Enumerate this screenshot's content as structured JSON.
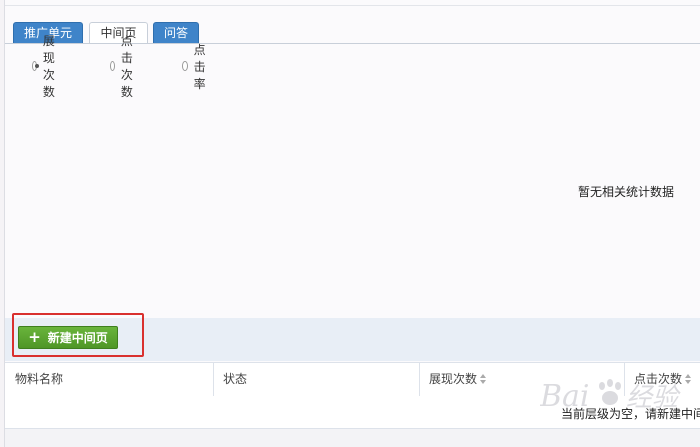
{
  "tabs": [
    {
      "label": "推广单元",
      "active": false
    },
    {
      "label": "中间页",
      "active": true
    },
    {
      "label": "问答",
      "active": false
    }
  ],
  "metrics": {
    "options": [
      {
        "label": "展现次数",
        "checked": true
      },
      {
        "label": "点击次数",
        "checked": false
      },
      {
        "label": "点击率",
        "checked": false
      }
    ]
  },
  "chart_area": {
    "empty_text": "暂无相关统计数据"
  },
  "toolbar": {
    "new_button_label": "新建中间页"
  },
  "table": {
    "columns": [
      "物料名称",
      "状态",
      "展现次数",
      "点击次数"
    ],
    "empty_text": "当前层级为空，请新建中间页"
  },
  "watermark": {
    "text": "Bai经验"
  },
  "colors": {
    "tab_blue": "#3f84c9",
    "button_green": "#5aa52f",
    "highlight_red": "#d9302e",
    "toolbar_bg": "#e8eef6"
  }
}
